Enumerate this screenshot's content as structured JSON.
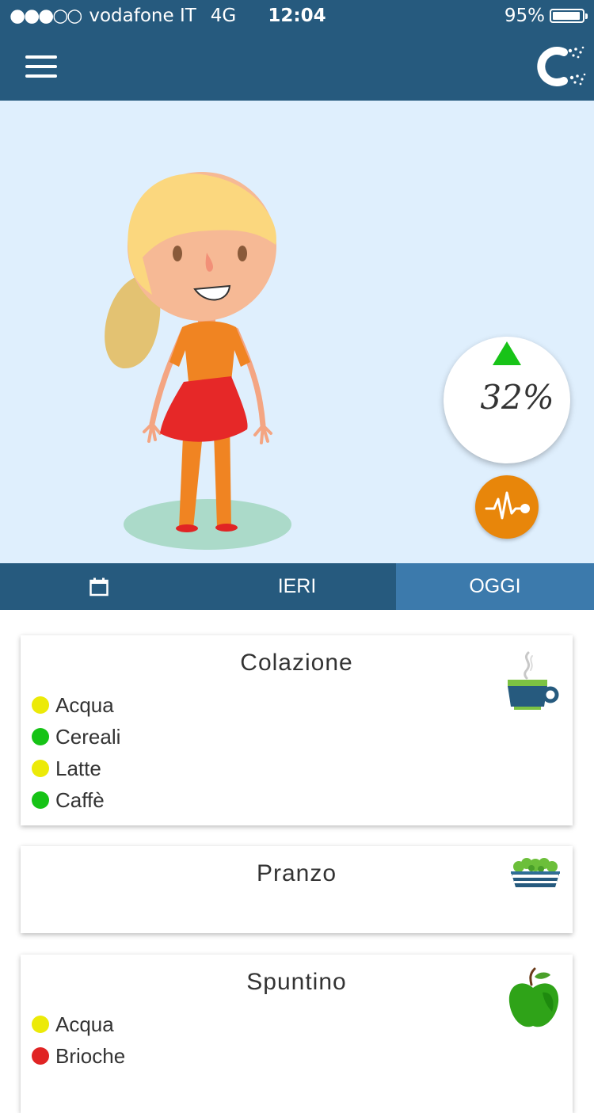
{
  "status_bar": {
    "signal": "●●●○○",
    "carrier": "vodafone IT",
    "network": "4G",
    "time": "12:04",
    "battery": "95%",
    "battery_level": 0.95
  },
  "header": {
    "menu_icon": "hamburger-menu-icon",
    "logo": "app-logo"
  },
  "hero": {
    "trend_icon": "up-triangle-icon",
    "trend_color": "#18c318",
    "percentage": "32%",
    "pulse_icon": "heartbeat-icon",
    "pulse_color": "#e8860a"
  },
  "tabs": [
    {
      "icon": "calendar-icon",
      "label": ""
    },
    {
      "label": "IERI"
    },
    {
      "label": "OGGI",
      "active": true
    }
  ],
  "meals": [
    {
      "title": "Colazione",
      "icon": "coffee-cup-icon",
      "items": [
        {
          "label": "Acqua",
          "status": "yellow"
        },
        {
          "label": "Cereali",
          "status": "green"
        },
        {
          "label": "Latte",
          "status": "yellow"
        },
        {
          "label": "Caffè",
          "status": "green"
        }
      ]
    },
    {
      "title": "Pranzo",
      "icon": "salad-bowl-icon",
      "items": []
    },
    {
      "title": "Spuntino",
      "icon": "apple-icon",
      "items": [
        {
          "label": "Acqua",
          "status": "yellow"
        },
        {
          "label": "Brioche",
          "status": "red"
        }
      ]
    }
  ],
  "colors": {
    "header": "#265a7e",
    "tab_active": "#3c7aac",
    "hero_bg": "#dfeffd",
    "yellow": "#ecea08",
    "green": "#16c316",
    "red": "#e02424"
  }
}
